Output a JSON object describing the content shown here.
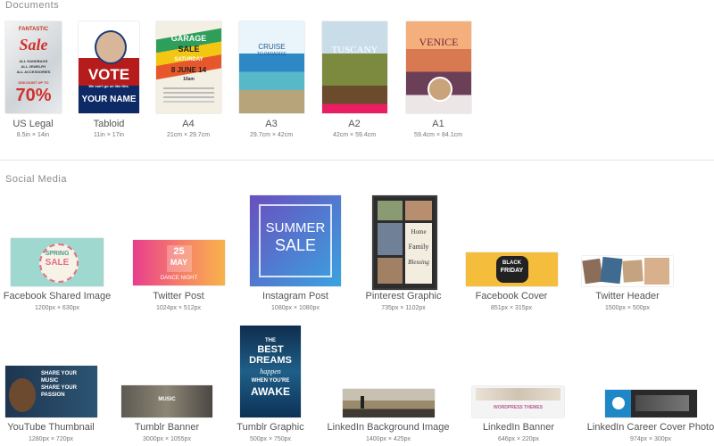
{
  "sections": {
    "documents_title": "Documents",
    "social_title": "Social Media"
  },
  "documents": [
    {
      "label": "US Legal",
      "dims": "8.5in × 14in",
      "art": [
        "FANTASTIC",
        "Sale",
        "ALL HANDBAGS",
        "ALL JEWELRY",
        "ALL ACCESSORIES",
        "DISCOUNT UP TO",
        "70%"
      ]
    },
    {
      "label": "Tabloid",
      "dims": "11in × 17in",
      "art": [
        "VOTE",
        "We can't go on like this.",
        "YOUR NAME"
      ]
    },
    {
      "label": "A4",
      "dims": "21cm × 29.7cm",
      "art": [
        "GARAGE",
        "SALE",
        "SATURDAY",
        "8 JUNE 14",
        "10am"
      ]
    },
    {
      "label": "A3",
      "dims": "29.7cm × 42cm",
      "art": [
        "CRUISE",
        "TO PARADISE"
      ]
    },
    {
      "label": "A2",
      "dims": "42cm × 59.4cm",
      "art": [
        "TUSCANY"
      ]
    },
    {
      "label": "A1",
      "dims": "59.4cm × 84.1cm",
      "art": [
        "VENICE"
      ]
    }
  ],
  "social": [
    {
      "label": "Facebook Shared Image",
      "dims": "1200px × 630px",
      "art": [
        "SPRING",
        "SALE"
      ]
    },
    {
      "label": "Twitter Post",
      "dims": "1024px × 512px",
      "art": [
        "25",
        "MAY",
        "DANCE NIGHT"
      ]
    },
    {
      "label": "Instagram Post",
      "dims": "1080px × 1080px",
      "art": [
        "SUMMER",
        "SALE"
      ]
    },
    {
      "label": "Pinterest Graphic",
      "dims": "735px × 1102px",
      "art": [
        "Home",
        "Family",
        "Blessing"
      ]
    },
    {
      "label": "Facebook Cover",
      "dims": "851px × 315px",
      "art": [
        "BLACK",
        "FRIDAY"
      ]
    },
    {
      "label": "Twitter Header",
      "dims": "1500px × 500px",
      "art": []
    },
    {
      "label": "YouTube Thumbnail",
      "dims": "1280px × 720px",
      "art": [
        "SHARE YOUR",
        "MUSIC",
        "SHARE YOUR",
        "PASSION"
      ]
    },
    {
      "label": "Tumblr Banner",
      "dims": "3000px × 1055px",
      "art": [
        "MUSIC"
      ]
    },
    {
      "label": "Tumblr Graphic",
      "dims": "500px × 750px",
      "art": [
        "THE",
        "BEST",
        "DREAMS",
        "happen",
        "WHEN YOU'RE",
        "AWAKE"
      ]
    },
    {
      "label": "LinkedIn Background Image",
      "dims": "1400px × 425px",
      "art": []
    },
    {
      "label": "LinkedIn Banner",
      "dims": "646px × 220px",
      "art": [
        "WORDPRESS THEMES"
      ]
    },
    {
      "label": "LinkedIn Career Cover Photo",
      "dims": "974px × 300px",
      "art": []
    }
  ]
}
